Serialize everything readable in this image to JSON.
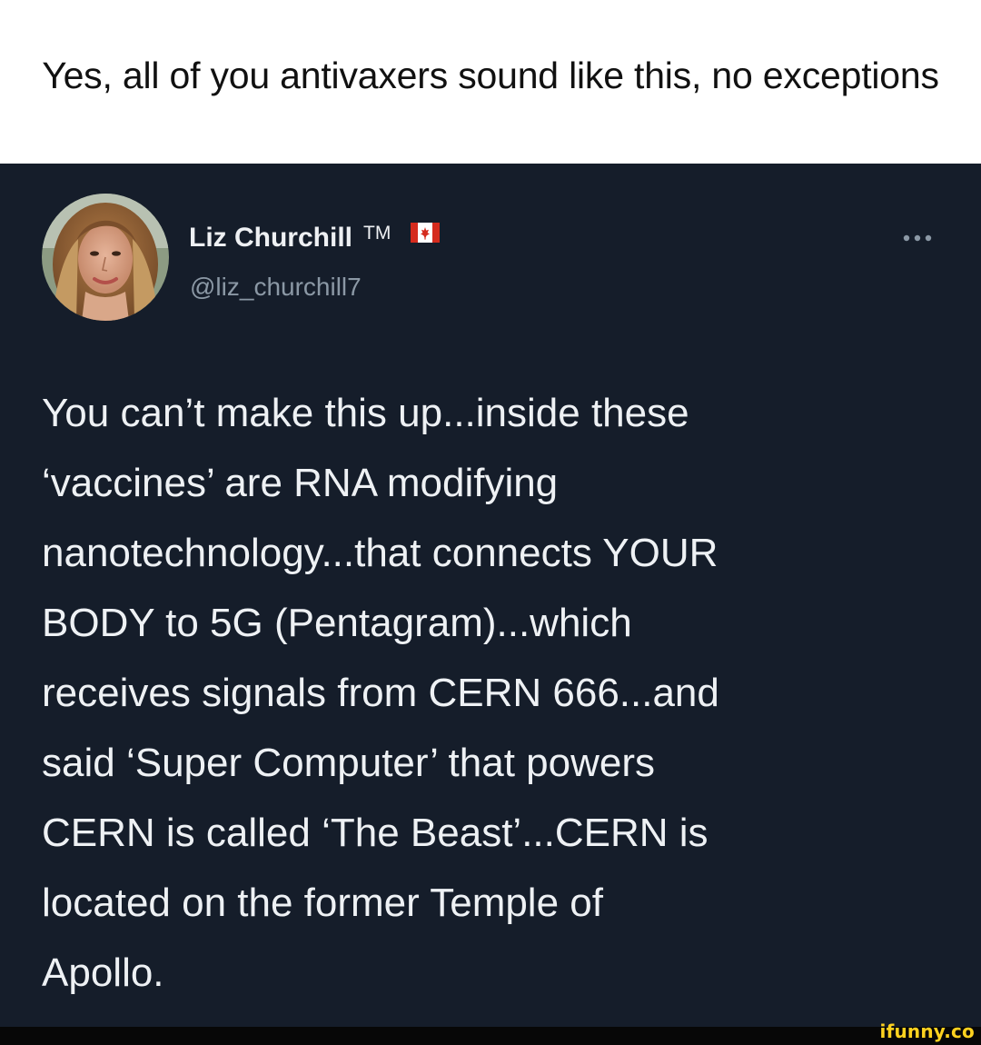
{
  "caption": {
    "text": "Yes, all of you antivaxers sound like this, no exceptions"
  },
  "tweet": {
    "author": {
      "display_name": "Liz Churchill",
      "trademark": "TM",
      "flag_icon": "canada-flag-icon",
      "handle": "@liz_churchill7",
      "avatar_icon": "profile-photo"
    },
    "more_icon": "more-options-icon",
    "text_lines": [
      "You can’t make this up...inside these",
      "‘vaccines’ are RNA modifying",
      "nanotechnology...that connects YOUR",
      "BODY to 5G (Pentagram)...which",
      "receives signals from CERN 666...and",
      "said ‘Super Computer’ that powers",
      "CERN is called ‘The Beast’...CERN is",
      "located on the former Temple of",
      "Apollo."
    ]
  },
  "watermark": {
    "text": "ifunny.co"
  },
  "colors": {
    "tweet_background": "#151d2a",
    "tweet_text": "#eef1f4",
    "handle_text": "#8b98a5",
    "caption_text": "#111111",
    "watermark": "#ffd21f",
    "flag_red": "#d52b1e"
  }
}
